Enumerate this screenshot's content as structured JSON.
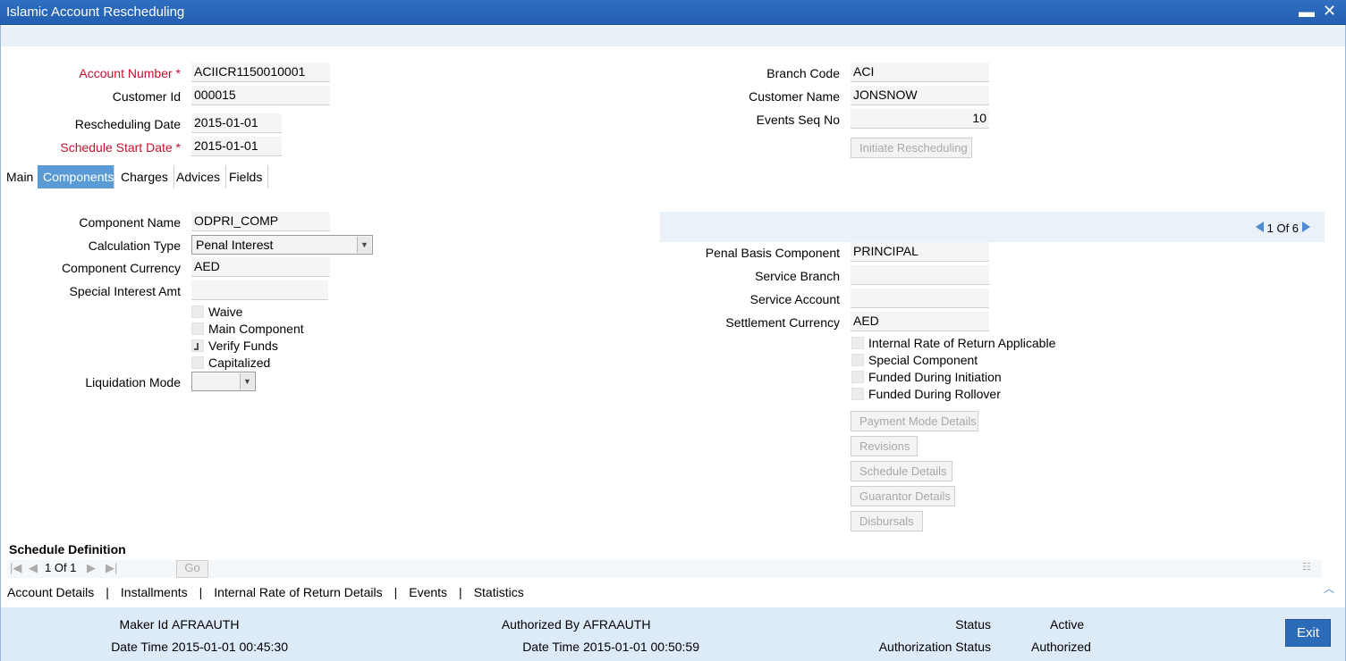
{
  "window": {
    "title": "Islamic Account Rescheduling",
    "minimize": "▬",
    "close": "✕"
  },
  "header": {
    "account_number_label": "Account Number",
    "account_number": "ACIICR1150010001",
    "customer_id_label": "Customer Id",
    "customer_id": "000015",
    "rescheduling_date_label": "Rescheduling Date",
    "rescheduling_date": "2015-01-01",
    "schedule_start_date_label": "Schedule Start Date",
    "schedule_start_date": "2015-01-01",
    "branch_code_label": "Branch Code",
    "branch_code": "ACI",
    "customer_name_label": "Customer Name",
    "customer_name": "JONSNOW",
    "events_seq_no_label": "Events Seq No",
    "events_seq_no": "10",
    "initiate_button": "Initiate Rescheduling",
    "required_marker": "*"
  },
  "tabs": [
    "Main",
    "Components",
    "Charges",
    "Advices",
    "Fields"
  ],
  "active_tab": "Components",
  "components": {
    "component_name_label": "Component Name",
    "component_name": "ODPRI_COMP",
    "calculation_type_label": "Calculation Type",
    "calculation_type": "Penal Interest",
    "component_currency_label": "Component Currency",
    "component_currency": "AED",
    "special_interest_amt_label": "Special Interest Amt",
    "special_interest_amt": "",
    "checkboxes_left": [
      {
        "label": "Waive",
        "checked": false
      },
      {
        "label": "Main Component",
        "checked": false
      },
      {
        "label": "Verify Funds",
        "checked": "indeterminate"
      },
      {
        "label": "Capitalized",
        "checked": false
      }
    ],
    "liquidation_mode_label": "Liquidation Mode",
    "liquidation_mode": "",
    "pager": {
      "text": "1 Of 6"
    },
    "penal_basis_component_label": "Penal Basis Component",
    "penal_basis_component": "PRINCIPAL",
    "service_branch_label": "Service Branch",
    "service_branch": "",
    "service_account_label": "Service Account",
    "service_account": "",
    "settlement_currency_label": "Settlement Currency",
    "settlement_currency": "AED",
    "checkboxes_right": [
      {
        "label": "Internal Rate of Return Applicable",
        "checked": false
      },
      {
        "label": "Special Component",
        "checked": false
      },
      {
        "label": "Funded During Initiation",
        "checked": false
      },
      {
        "label": "Funded During Rollover",
        "checked": false
      }
    ],
    "buttons": [
      "Payment Mode Details",
      "Revisions",
      "Schedule Details",
      "Guarantor Details",
      "Disbursals"
    ]
  },
  "schedule": {
    "title": "Schedule Definition",
    "page_text": "1 Of 1",
    "go_button": "Go"
  },
  "bottom_links": [
    "Account Details",
    "Installments",
    "Internal Rate of Return Details",
    "Events",
    "Statistics"
  ],
  "bottom_sep": "|",
  "footer": {
    "maker_id_label": "Maker Id",
    "maker_id": "AFRAAUTH",
    "maker_datetime_label": "Date Time",
    "maker_datetime": "2015-01-01 00:45:30",
    "authorized_by_label": "Authorized By",
    "authorized_by": "AFRAAUTH",
    "auth_datetime_label": "Date Time",
    "auth_datetime": "2015-01-01 00:50:59",
    "status_label": "Status",
    "status": "Active",
    "authorization_status_label": "Authorization Status",
    "authorization_status": "Authorized",
    "exit_button": "Exit"
  },
  "colors": {
    "titlebar": "#2f6fc0",
    "active_tab": "#5b9bd5",
    "required": "#c8102e",
    "footer": "#ddeaf7",
    "exit": "#2c6bb8"
  }
}
